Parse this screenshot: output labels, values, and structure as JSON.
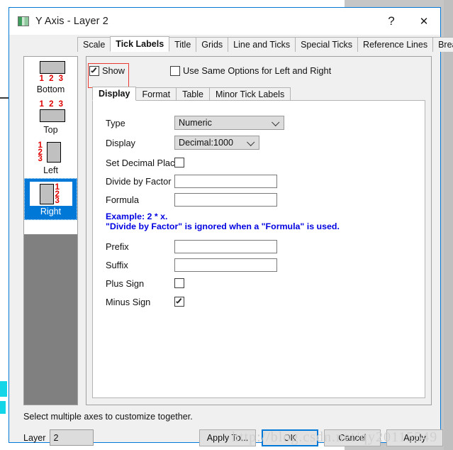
{
  "window": {
    "title": "Y Axis - Layer 2",
    "icon": "axis-layer-icon",
    "help_label": "?",
    "close_label": "✕"
  },
  "tabs": [
    {
      "label": "Scale",
      "active": false
    },
    {
      "label": "Tick Labels",
      "active": true
    },
    {
      "label": "Title",
      "active": false
    },
    {
      "label": "Grids",
      "active": false
    },
    {
      "label": "Line and Ticks",
      "active": false
    },
    {
      "label": "Special Ticks",
      "active": false
    },
    {
      "label": "Reference Lines",
      "active": false
    },
    {
      "label": "Breaks",
      "active": false
    }
  ],
  "axis_list": [
    {
      "label": "Bottom",
      "selected": false
    },
    {
      "label": "Top",
      "selected": false
    },
    {
      "label": "Left",
      "selected": false
    },
    {
      "label": "Right",
      "selected": true
    }
  ],
  "axis_thumb_digits": "1 2 3",
  "options": {
    "show": {
      "label": "Show",
      "checked": true
    },
    "use_same": {
      "label": "Use Same Options for Left and Right",
      "checked": false
    }
  },
  "inner_tabs": [
    {
      "label": "Display",
      "active": true
    },
    {
      "label": "Format",
      "active": false
    },
    {
      "label": "Table",
      "active": false
    },
    {
      "label": "Minor Tick Labels",
      "active": false
    }
  ],
  "fields": {
    "type": {
      "label": "Type",
      "value": "Numeric"
    },
    "display": {
      "label": "Display",
      "value": "Decimal:1000"
    },
    "set_decimal_places": {
      "label": "Set Decimal Places",
      "checked": false
    },
    "divide_by_factor": {
      "label": "Divide by Factor",
      "value": ""
    },
    "formula": {
      "label": "Formula",
      "value": ""
    },
    "prefix": {
      "label": "Prefix",
      "value": ""
    },
    "suffix": {
      "label": "Suffix",
      "value": ""
    },
    "plus_sign": {
      "label": "Plus Sign",
      "checked": false
    },
    "minus_sign": {
      "label": "Minus Sign",
      "checked": true
    }
  },
  "example": {
    "line1": "Example: 2 * x.",
    "line2": "\"Divide by Factor\" is ignored when a \"Formula\" is used.",
    "color": "#0000e0"
  },
  "footer": {
    "note": "Select multiple axes to customize together.",
    "layer_label": "Layer",
    "layer_value": "2",
    "buttons": [
      {
        "label": "Apply To...",
        "primary": false
      },
      {
        "label": "OK",
        "primary": true
      },
      {
        "label": "Cancel",
        "primary": false
      },
      {
        "label": "Apply",
        "primary": false
      }
    ]
  },
  "watermark": "http://blog.csdn.net/qy20115549",
  "colors": {
    "accent": "#0078d7",
    "highlight_box": "#e8382f",
    "digits_red": "#e00000",
    "selection_blue": "#0078d7"
  }
}
